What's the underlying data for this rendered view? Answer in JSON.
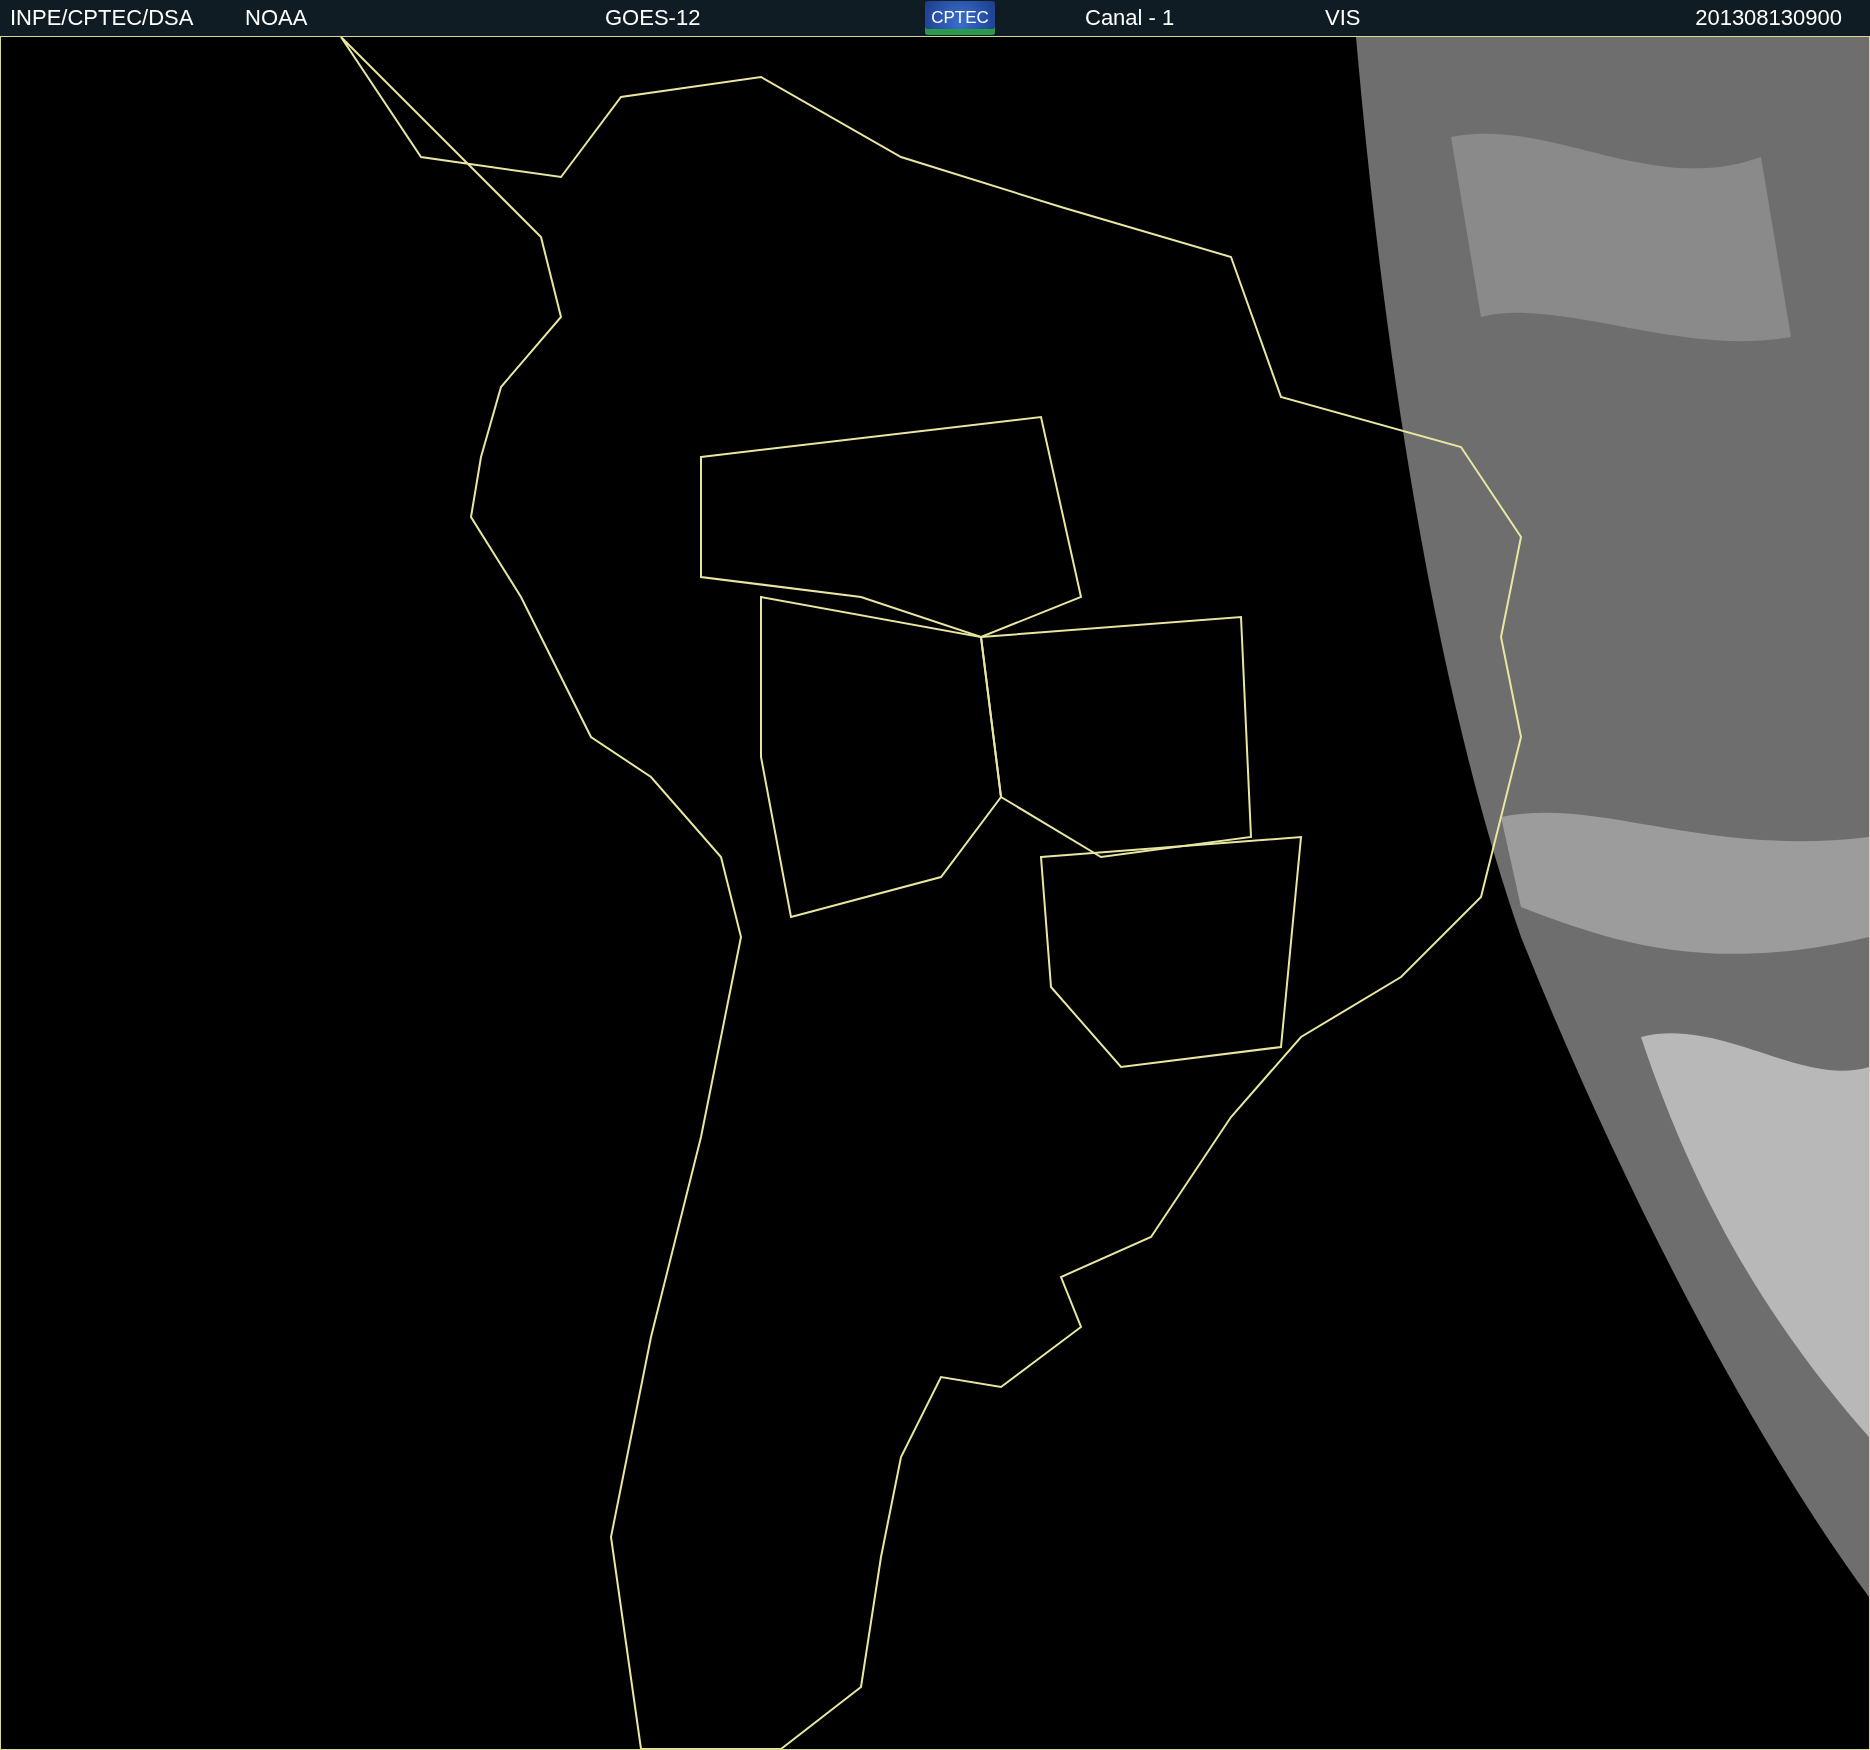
{
  "header": {
    "items": [
      {
        "kind": "text",
        "text": "INPE/CPTEC/DSA"
      },
      {
        "kind": "text",
        "text": "NOAA"
      },
      {
        "kind": "text",
        "text": "GOES-12"
      },
      {
        "kind": "logo",
        "text": "CPTEC"
      },
      {
        "kind": "text",
        "text": "Canal - 1"
      },
      {
        "kind": "text",
        "text": "VIS"
      },
      {
        "kind": "text",
        "text": "201308130900"
      }
    ]
  }
}
